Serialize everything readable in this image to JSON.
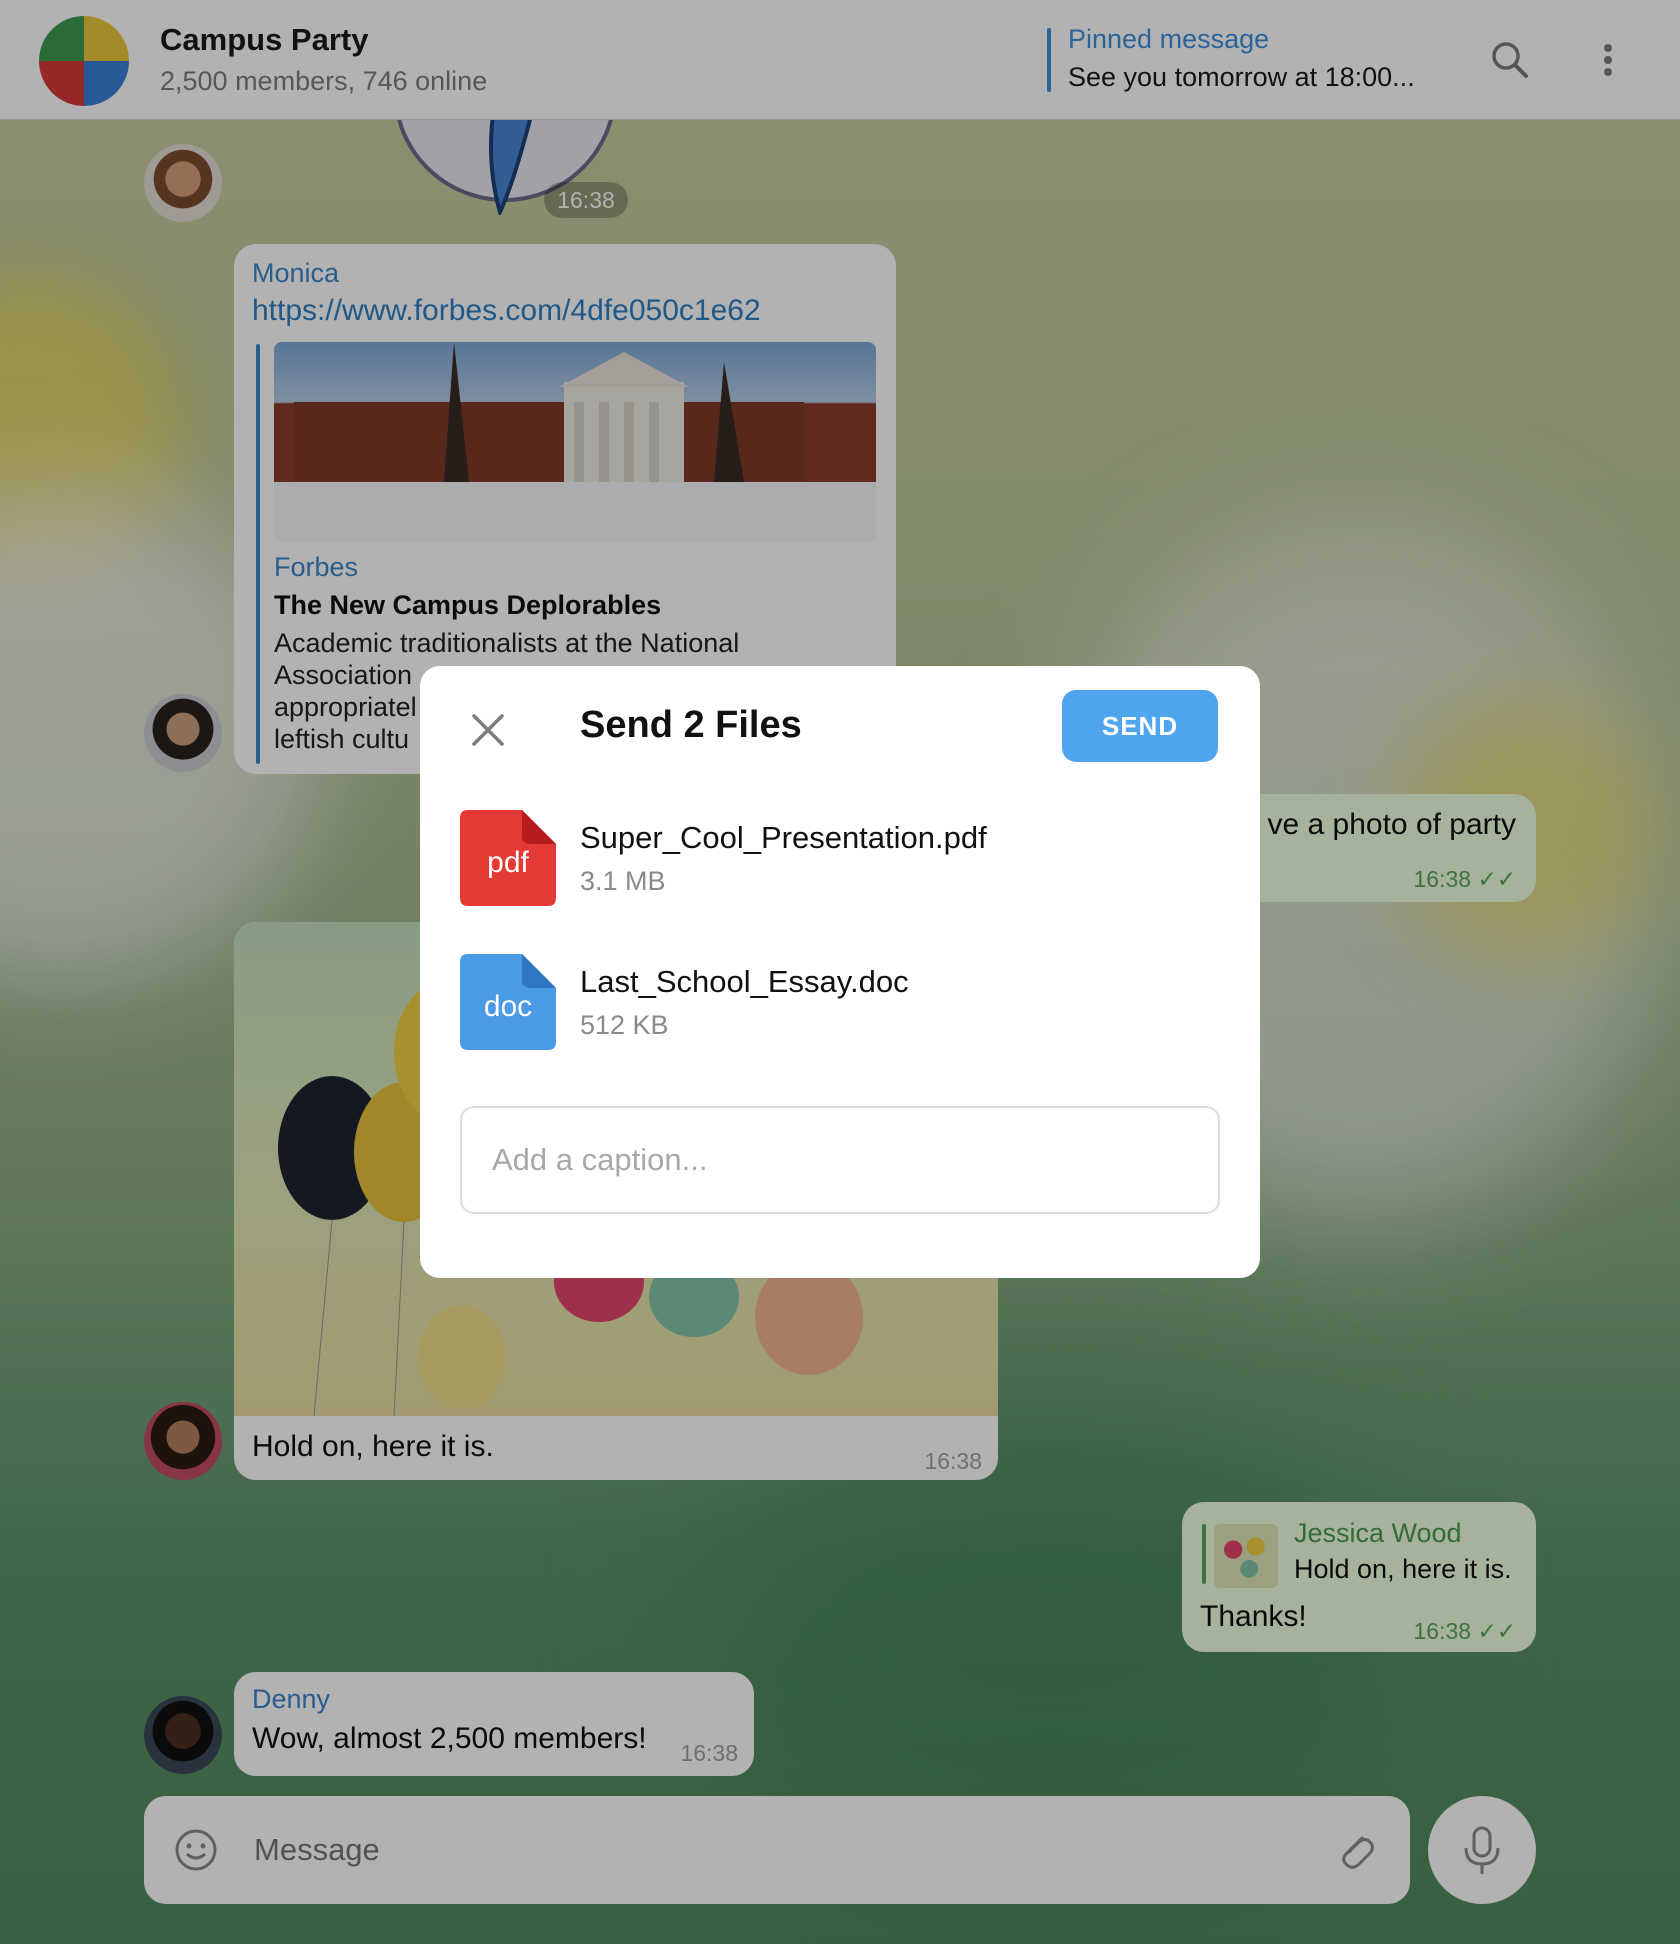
{
  "header": {
    "title": "Campus Party",
    "subtitle": "2,500 members, 746 online",
    "pinned_label": "Pinned message",
    "pinned_text": "See you tomorrow at 18:00..."
  },
  "messages": {
    "sticker_time": "16:38",
    "monica": {
      "sender": "Monica",
      "link": "https://www.forbes.com/4dfe050c1e62",
      "site": "Forbes",
      "preview_title": "The New Campus Deplorables",
      "preview_line1": "Academic traditionalists at the National",
      "preview_line2": "Association",
      "preview_line3": "appropriatel",
      "preview_line4": "leftish cultu"
    },
    "out_photo_request": {
      "text": "ve a photo of party",
      "time": "16:38"
    },
    "jessica_photo": {
      "text": "Hold on, here it is.",
      "time": "16:38"
    },
    "out_thanks": {
      "reply_name": "Jessica Wood",
      "reply_text": "Hold on, here it is.",
      "text": "Thanks!",
      "time": "16:38"
    },
    "denny": {
      "sender": "Denny",
      "text": "Wow, almost 2,500 members!",
      "time": "16:38"
    }
  },
  "composer": {
    "placeholder": "Message"
  },
  "modal": {
    "title": "Send 2 Files",
    "send_label": "SEND",
    "files": [
      {
        "icon_label": "pdf",
        "name": "Super_Cool_Presentation.pdf",
        "size": "3.1 MB",
        "color": "#e53935"
      },
      {
        "icon_label": "doc",
        "name": "Last_School_Essay.doc",
        "size": "512 KB",
        "color": "#3d8fd8"
      }
    ],
    "caption_placeholder": "Add a caption..."
  },
  "colors": {
    "accent": "#50a6ee",
    "link": "#3d86c9",
    "outgoing_bubble": "#eeffde",
    "check_green": "#55a45a"
  }
}
